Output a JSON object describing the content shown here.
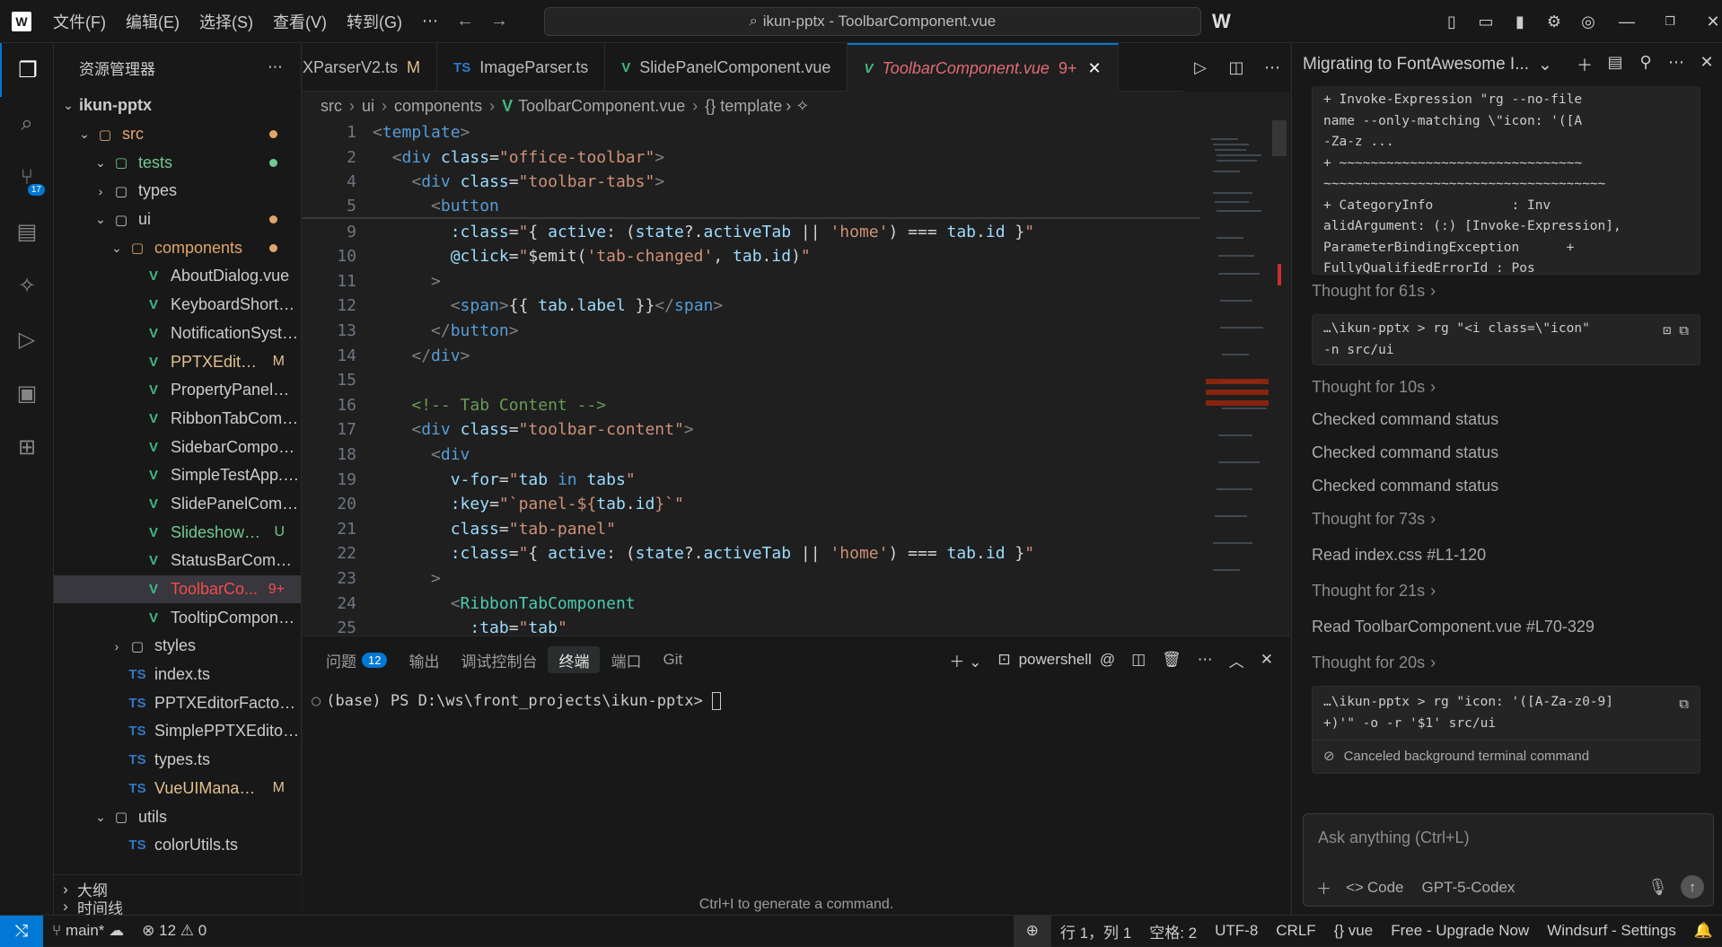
{
  "menu": [
    "文件(F)",
    "编辑(E)",
    "选择(S)",
    "查看(V)",
    "转到(G)"
  ],
  "search": {
    "text": "ikun-pptx - ToolbarComponent.vue"
  },
  "sidebar": {
    "title": "资源管理器",
    "rows": [
      {
        "label": "ikun-pptx",
        "indent": 0,
        "chev": "∨",
        "type": "root"
      },
      {
        "label": "src",
        "indent": 1,
        "chev": "∨",
        "type": "folder",
        "color": "orange",
        "dot": "#e2a567"
      },
      {
        "label": "tests",
        "indent": 2,
        "chev": "∨",
        "type": "folder",
        "color": "green",
        "dot": "#73c991"
      },
      {
        "label": "types",
        "indent": 2,
        "chev": ">",
        "type": "folder"
      },
      {
        "label": "ui",
        "indent": 2,
        "chev": "∨",
        "type": "folder",
        "dot": "#e2a567"
      },
      {
        "label": "components",
        "indent": 3,
        "chev": "∨",
        "type": "folder",
        "color": "orange",
        "dot": "#e2a567"
      },
      {
        "label": "AboutDialog.vue",
        "indent": 4,
        "type": "vue"
      },
      {
        "label": "KeyboardShortcu...",
        "indent": 4,
        "type": "vue"
      },
      {
        "label": "NotificationSyste...",
        "indent": 4,
        "type": "vue"
      },
      {
        "label": "PPTXEditor...",
        "indent": 4,
        "type": "vue",
        "color": "yellow",
        "status": "M"
      },
      {
        "label": "PropertyPanelCo...",
        "indent": 4,
        "type": "vue"
      },
      {
        "label": "RibbonTabComp...",
        "indent": 4,
        "type": "vue"
      },
      {
        "label": "SidebarCompone...",
        "indent": 4,
        "type": "vue"
      },
      {
        "label": "SimpleTestApp.vue",
        "indent": 4,
        "type": "vue"
      },
      {
        "label": "SlidePanelComp...",
        "indent": 4,
        "type": "vue"
      },
      {
        "label": "SlideshowC...",
        "indent": 4,
        "type": "vue",
        "color": "green",
        "status": "U"
      },
      {
        "label": "StatusBarCompo...",
        "indent": 4,
        "type": "vue"
      },
      {
        "label": "ToolbarCo...",
        "indent": 4,
        "type": "vue",
        "color": "red",
        "status": "9+",
        "selected": true
      },
      {
        "label": "TooltipCompone...",
        "indent": 4,
        "type": "vue"
      },
      {
        "label": "styles",
        "indent": 3,
        "chev": ">",
        "type": "folder"
      },
      {
        "label": "index.ts",
        "indent": 3,
        "type": "ts"
      },
      {
        "label": "PPTXEditorFactory.ts",
        "indent": 3,
        "type": "ts"
      },
      {
        "label": "SimplePPTXEditor.ts",
        "indent": 3,
        "type": "ts"
      },
      {
        "label": "types.ts",
        "indent": 3,
        "type": "ts"
      },
      {
        "label": "VueUIManag...",
        "indent": 3,
        "type": "ts",
        "color": "yellow",
        "status": "M"
      },
      {
        "label": "utils",
        "indent": 2,
        "chev": "∨",
        "type": "folder"
      },
      {
        "label": "colorUtils.ts",
        "indent": 3,
        "type": "ts"
      }
    ],
    "outline": "大纲",
    "timeline": "时间线"
  },
  "tabs": [
    {
      "label": "XParserV2.ts",
      "icon": "",
      "mod": "M"
    },
    {
      "label": "ImageParser.ts",
      "icon": "TS"
    },
    {
      "label": "SlidePanelComponent.vue",
      "icon": "V"
    },
    {
      "label": "ToolbarComponent.vue",
      "icon": "V",
      "mod": "9+",
      "active": true
    }
  ],
  "breadcrumb": [
    "src",
    "ui",
    "components",
    "ToolbarComponent.vue",
    "{} template"
  ],
  "code": [
    {
      "n": "1",
      "html": "<span class='k-pun'>&lt;</span><span class='k-tag'>template</span><span class='k-pun'>&gt;</span>"
    },
    {
      "n": "2",
      "html": "  <span class='k-pun'>&lt;</span><span class='k-tag'>div</span> <span class='k-attr'>class</span>=<span class='k-str'>\"office-toolbar\"</span><span class='k-pun'>&gt;</span>"
    },
    {
      "n": "4",
      "html": "    <span class='k-pun'>&lt;</span><span class='k-tag'>div</span> <span class='k-attr'>class</span>=<span class='k-str'>\"toolbar-tabs\"</span><span class='k-pun'>&gt;</span>"
    },
    {
      "n": "5",
      "html": "      <span class='k-pun'>&lt;</span><span class='k-tag'>button</span>"
    },
    {
      "n": "9",
      "html": "        <span class='k-attr'>:class</span>=<span class='k-str'>\"</span>{ <span class='k-var'>active</span>: (<span class='k-var'>state</span>?.<span class='k-var'>activeTab</span> || <span class='k-str'>'home'</span>) === <span class='k-var'>tab</span>.<span class='k-var'>id</span> }<span class='k-str'>\"</span>"
    },
    {
      "n": "10",
      "html": "        <span class='k-attr'>@click</span>=<span class='k-str'>\"</span>$emit(<span class='k-str'>'tab-changed'</span>, <span class='k-var'>tab</span>.<span class='k-var'>id</span>)<span class='k-str'>\"</span>"
    },
    {
      "n": "11",
      "html": "      <span class='k-pun'>&gt;</span>"
    },
    {
      "n": "12",
      "html": "        <span class='k-pun'>&lt;</span><span class='k-tag'>span</span><span class='k-pun'>&gt;</span>{{ <span class='k-var'>tab</span>.<span class='k-var'>label</span> }}<span class='k-pun'>&lt;/</span><span class='k-tag'>span</span><span class='k-pun'>&gt;</span>"
    },
    {
      "n": "13",
      "html": "      <span class='k-pun'>&lt;/</span><span class='k-tag'>button</span><span class='k-pun'>&gt;</span>"
    },
    {
      "n": "14",
      "html": "    <span class='k-pun'>&lt;/</span><span class='k-tag'>div</span><span class='k-pun'>&gt;</span>"
    },
    {
      "n": "15",
      "html": ""
    },
    {
      "n": "16",
      "html": "    <span class='k-cmt'>&lt;!-- Tab Content --&gt;</span>"
    },
    {
      "n": "17",
      "html": "    <span class='k-pun'>&lt;</span><span class='k-tag'>div</span> <span class='k-attr'>class</span>=<span class='k-str'>\"toolbar-content\"</span><span class='k-pun'>&gt;</span>"
    },
    {
      "n": "18",
      "html": "      <span class='k-pun'>&lt;</span><span class='k-tag'>div</span>"
    },
    {
      "n": "19",
      "html": "        <span class='k-attr'>v-for</span>=<span class='k-str'>\"</span><span class='k-var'>tab</span> <span class='k-kw'>in</span> <span class='k-var'>tabs</span><span class='k-str'>\"</span>"
    },
    {
      "n": "20",
      "html": "        <span class='k-attr'>:key</span>=<span class='k-str'>\"`panel-${</span><span class='k-var'>tab</span>.<span class='k-var'>id</span><span class='k-str'>}`\"</span>"
    },
    {
      "n": "21",
      "html": "        <span class='k-attr'>class</span>=<span class='k-str'>\"tab-panel\"</span>"
    },
    {
      "n": "22",
      "html": "        <span class='k-attr'>:class</span>=<span class='k-str'>\"</span>{ <span class='k-var'>active</span>: (<span class='k-var'>state</span>?.<span class='k-var'>activeTab</span> || <span class='k-str'>'home'</span>) === <span class='k-var'>tab</span>.<span class='k-var'>id</span> }<span class='k-str'>\"</span>"
    },
    {
      "n": "23",
      "html": "      <span class='k-pun'>&gt;</span>"
    },
    {
      "n": "24",
      "html": "        <span class='k-pun'>&lt;</span><span class='k-comp'>RibbonTabComponent</span>"
    },
    {
      "n": "25",
      "html": "          <span class='k-attr'>:tab</span>=<span class='k-str'>\"</span><span class='k-var'>tab</span><span class='k-str'>\"</span>"
    }
  ],
  "panel": {
    "tabs": [
      {
        "label": "问题",
        "count": "12"
      },
      {
        "label": "输出"
      },
      {
        "label": "调试控制台"
      },
      {
        "label": "终端",
        "active": true
      },
      {
        "label": "端口"
      },
      {
        "label": "Git"
      }
    ],
    "shell": "powershell",
    "prompt": "(base) PS D:\\ws\\front_projects\\ikun-pptx> ",
    "hint": "Ctrl+I to generate a command."
  },
  "chat": {
    "title": "Migrating to FontAwesome I...",
    "box1": [
      "+ Invoke-Expression \"rg --no-file",
      "name --only-matching \\\"icon: '([A",
      "-Za-z ...",
      "+ ~~~~~~~~~~~~~~~~~~~~~~~~~~~~~~~",
      "~~~~~~~~~~~~~~~~~~~~~~~~~~~~~~~~~~~~",
      "+ CategoryInfo          : Inv",
      "alidArgument: (:) [Invoke-Expression],",
      "ParameterBindingException      +",
      "FullyQualifiedErrorId : Pos"
    ],
    "thought1": "Thought for 61s",
    "box2": [
      "…\\ikun-pptx > rg \"<i class=\\\"icon\"",
      "-n src/ui"
    ],
    "thought2": "Thought for 10s",
    "checked": [
      "Checked command status",
      "Checked command status",
      "Checked command status"
    ],
    "thought3": "Thought for 73s",
    "read1": "Read index.css #L1-120",
    "thought4": "Thought for 21s",
    "read2": "Read ToolbarComponent.vue #L70-329",
    "thought5": "Thought for 20s",
    "box3": [
      "…\\ikun-pptx > rg \"icon: '([A-Za-z0-9]",
      "+)'\" -o -r '$1' src/ui"
    ],
    "canceled": "Canceled background terminal command",
    "input_placeholder": "Ask anything (Ctrl+L)",
    "code_label": "Code",
    "model": "GPT-5-Codex"
  },
  "statusbar": {
    "branch": "main*",
    "errors": "12",
    "warnings": "0",
    "position": "行 1，列 1",
    "spaces": "空格: 2",
    "encoding": "UTF-8",
    "eol": "CRLF",
    "lang": "vue",
    "upgrade": "Free - Upgrade Now",
    "settings": "Windsurf - Settings"
  },
  "colors": {
    "accent": "#0078d4",
    "background": "#1f1f1f",
    "sidebar": "#181818"
  }
}
